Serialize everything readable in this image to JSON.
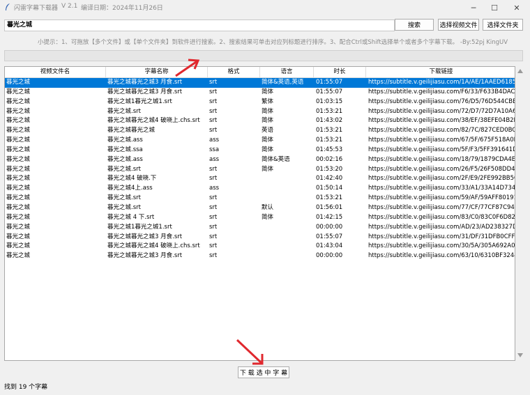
{
  "window": {
    "title": "闪雷字幕下载器",
    "version": "V 2.1",
    "build_date": "编译日期：2024年11月26日",
    "minimize": "─",
    "maximize": "☐",
    "close": "✕"
  },
  "search": {
    "value": "暮光之城"
  },
  "buttons": {
    "search": "搜索",
    "select_video": "选择视频文件",
    "select_folder": "选择文件夹",
    "download": "下 载 选 中 字 幕"
  },
  "tip": "小提示：1、可拖放【多个文件】或【单个文件夹】到软件进行搜索。2、搜索结果可单击对应列标题进行排序。3、配合Ctrl或Shift选择单个或者多个字幕下载。 -By:52pj KingUV",
  "table": {
    "columns": [
      "视频文件名",
      "字幕名称",
      "格式",
      "语言",
      "时长",
      "下载链接"
    ],
    "rows": [
      [
        "暮光之城",
        "暮光之城暮光之城3 月食.srt",
        "srt",
        "简体&英语,英语",
        "01:55:07",
        "https://subtitle.v.geilijiasu.com/1A/AE/1AAED6185F5E"
      ],
      [
        "暮光之城",
        "暮光之城暮光之城3 月食.srt",
        "srt",
        "简体",
        "01:55:07",
        "https://subtitle.v.geilijiasu.com/F6/33/F633B4DACB0C"
      ],
      [
        "暮光之城",
        "暮光之城1暮光之城1.srt",
        "srt",
        "繁体",
        "01:03:15",
        "https://subtitle.v.geilijiasu.com/76/D5/76D544CBB1C"
      ],
      [
        "暮光之城",
        "暮光之城.srt",
        "srt",
        "简体",
        "01:53:21",
        "https://subtitle.v.geilijiasu.com/72/D7/72D7A10A65E"
      ],
      [
        "暮光之城",
        "暮光之城暮光之城4 破晓上.chs.srt",
        "srt",
        "简体",
        "01:43:02",
        "https://subtitle.v.geilijiasu.com/38/EF/38EFE04B2D77"
      ],
      [
        "暮光之城",
        "暮光之城暮光之城",
        "srt",
        "英语",
        "01:53:21",
        "https://subtitle.v.geilijiasu.com/82/7C/827CED0BC96"
      ],
      [
        "暮光之城",
        "暮光之城.ass",
        "ass",
        "简体",
        "01:53:21",
        "https://subtitle.v.geilijiasu.com/67/5F/675F518A0EF1"
      ],
      [
        "暮光之城",
        "暮光之城.ssa",
        "ssa",
        "简体",
        "01:45:53",
        "https://subtitle.v.geilijiasu.com/5F/F3/5FF391641D76"
      ],
      [
        "暮光之城",
        "暮光之城.ass",
        "ass",
        "简体&英语",
        "00:02:16",
        "https://subtitle.v.geilijiasu.com/18/79/1879CDA4E31C"
      ],
      [
        "暮光之城",
        "暮光之城.srt",
        "srt",
        "简体",
        "01:53:20",
        "https://subtitle.v.geilijiasu.com/26/F5/26F508DD4A57"
      ],
      [
        "暮光之城",
        "暮光之城4 破晓.下",
        "srt",
        "",
        "01:42:40",
        "https://subtitle.v.geilijiasu.com/2F/E9/2FE992BB5C00"
      ],
      [
        "暮光之城",
        "暮光之城4上.ass",
        "ass",
        "",
        "01:50:14",
        "https://subtitle.v.geilijiasu.com/33/A1/33A14D734BFA"
      ],
      [
        "暮光之城",
        "暮光之城.srt",
        "srt",
        "",
        "01:53:21",
        "https://subtitle.v.geilijiasu.com/59/AF/59AFF8019143"
      ],
      [
        "暮光之城",
        "暮光之城.srt",
        "srt",
        "默认",
        "01:56:01",
        "https://subtitle.v.geilijiasu.com/77/CF/77CF87C94869"
      ],
      [
        "暮光之城",
        "暮光之城 4 下.srt",
        "srt",
        "简体",
        "01:42:15",
        "https://subtitle.v.geilijiasu.com/83/C0/83C0F6D82F1C"
      ],
      [
        "暮光之城",
        "暮光之城1暮光之城1.srt",
        "srt",
        "",
        "00:00:00",
        "https://subtitle.v.geilijiasu.com/AD/23/AD238327D54"
      ],
      [
        "暮光之城",
        "暮光之城暮光之城3 月食.srt",
        "srt",
        "",
        "01:55:07",
        "https://subtitle.v.geilijiasu.com/31/DF/31DFB0CFF841"
      ],
      [
        "暮光之城",
        "暮光之城暮光之城4 破晓上.chs.srt",
        "srt",
        "",
        "01:43:04",
        "https://subtitle.v.geilijiasu.com/30/5A/305A692A03D2"
      ],
      [
        "暮光之城",
        "暮光之城暮光之城3 月食.srt",
        "srt",
        "",
        "00:00:00",
        "https://subtitle.v.geilijiasu.com/63/10/6310BF32445E"
      ]
    ],
    "selected_row": 0
  },
  "status": "找到 19 个字幕",
  "colors": {
    "selection": "#0078d7",
    "annotation_arrow": "#e0282e"
  },
  "icons": {
    "app": "feather-icon",
    "scroll_up": "triangle-up-icon",
    "scroll_down": "triangle-down-icon"
  }
}
